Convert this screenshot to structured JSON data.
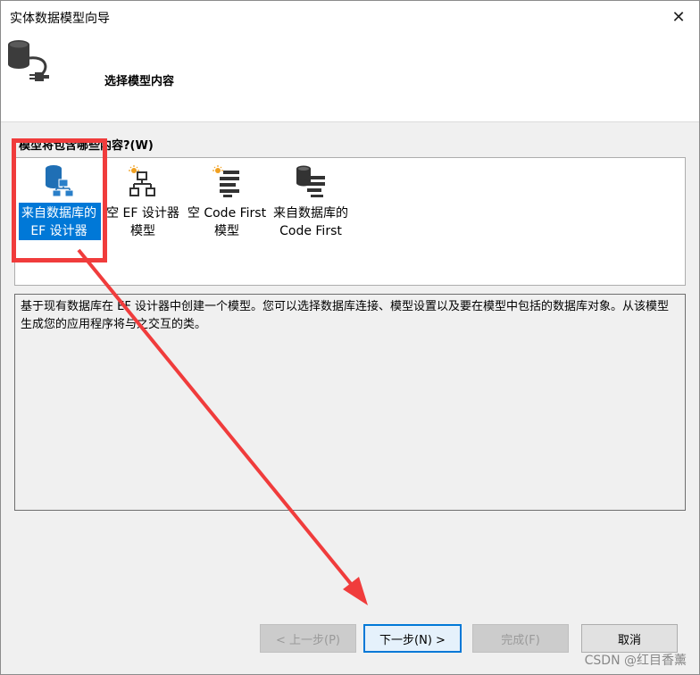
{
  "window": {
    "title": "实体数据模型向导",
    "close_label": "✕"
  },
  "header": {
    "title": "选择模型内容"
  },
  "question": "模型将包含哪些内容?(W)",
  "model_items": [
    {
      "label_line1": "来自数据库的",
      "label_line2": "EF 设计器",
      "selected": true
    },
    {
      "label_line1": "空 EF 设计器",
      "label_line2": "模型",
      "selected": false
    },
    {
      "label_line1": "空 Code First",
      "label_line2": "模型",
      "selected": false
    },
    {
      "label_line1": "来自数据库的",
      "label_line2": "Code First",
      "selected": false
    }
  ],
  "description": "基于现有数据库在 EF 设计器中创建一个模型。您可以选择数据库连接、模型设置以及要在模型中包括的数据库对象。从该模型生成您的应用程序将与之交互的类。",
  "buttons": {
    "prev": "< 上一步(P)",
    "next": "下一步(N) >",
    "finish": "完成(F)",
    "cancel": "取消"
  },
  "watermark": "CSDN @红目香薰",
  "colors": {
    "selection": "#0078d7",
    "annotation": "#f03c3c"
  }
}
